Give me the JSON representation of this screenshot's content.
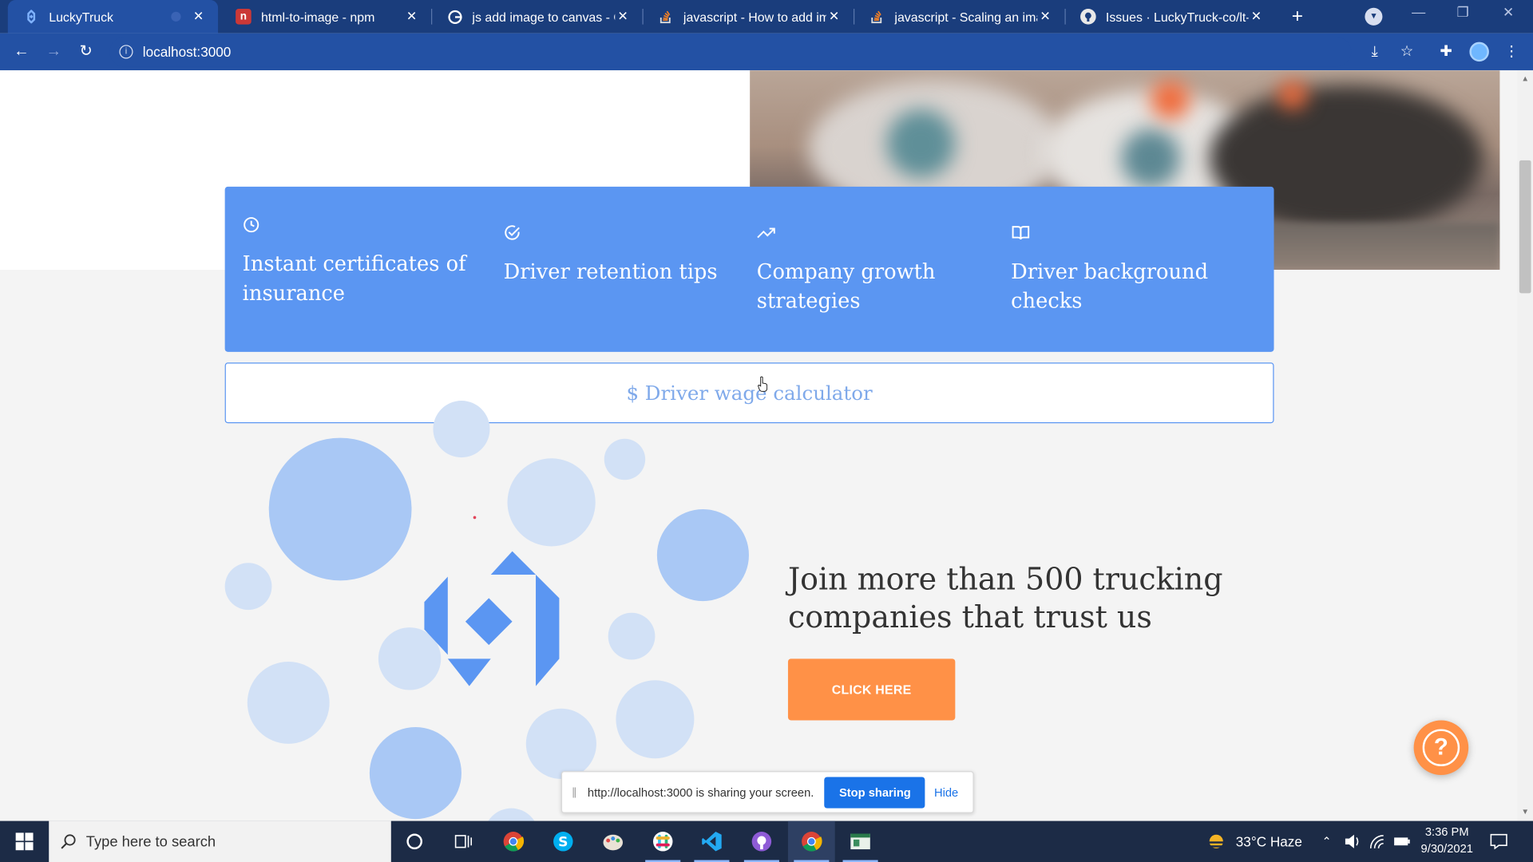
{
  "browser": {
    "tabs": [
      {
        "title": "LuckyTruck",
        "favicon": "luckytruck-logo-icon",
        "active": true
      },
      {
        "title": "html-to-image - npm",
        "favicon": "npm-icon"
      },
      {
        "title": "js add image to canvas - Go",
        "favicon": "google-icon"
      },
      {
        "title": "javascript - How to add ima",
        "favicon": "stackoverflow-icon"
      },
      {
        "title": "javascript - Scaling an imag",
        "favicon": "stackoverflow-icon"
      },
      {
        "title": "Issues · LuckyTruck-co/lt-fro",
        "favicon": "github-icon"
      }
    ],
    "close_glyph": "✕",
    "new_tab_glyph": "+",
    "url": "localhost:3000"
  },
  "page": {
    "features": [
      {
        "title": "Instant certificates of insurance",
        "icon": "clock-icon"
      },
      {
        "title": "Driver retention tips",
        "icon": "check-circle-icon"
      },
      {
        "title": "Company growth strategies",
        "icon": "trending-up-icon"
      },
      {
        "title": "Driver background checks",
        "icon": "book-icon"
      }
    ],
    "calculator_label": "$ Driver wage calculator",
    "headline": "Join more than 500 trucking companies that trust us",
    "cta_label": "CLICK HERE",
    "help_glyph": "?",
    "colors": {
      "feature_blue": "#5b96f2",
      "cta_orange": "#ff9147",
      "bubble_dark": "#a9c8f5",
      "bubble_light": "#d2e1f6"
    }
  },
  "share_banner": {
    "message": "http://localhost:3000 is sharing your screen.",
    "stop_label": "Stop sharing",
    "hide_label": "Hide"
  },
  "taskbar": {
    "search_placeholder": "Type here to search",
    "weather": "33°C  Haze",
    "time": "3:36 PM",
    "date": "9/30/2021"
  }
}
